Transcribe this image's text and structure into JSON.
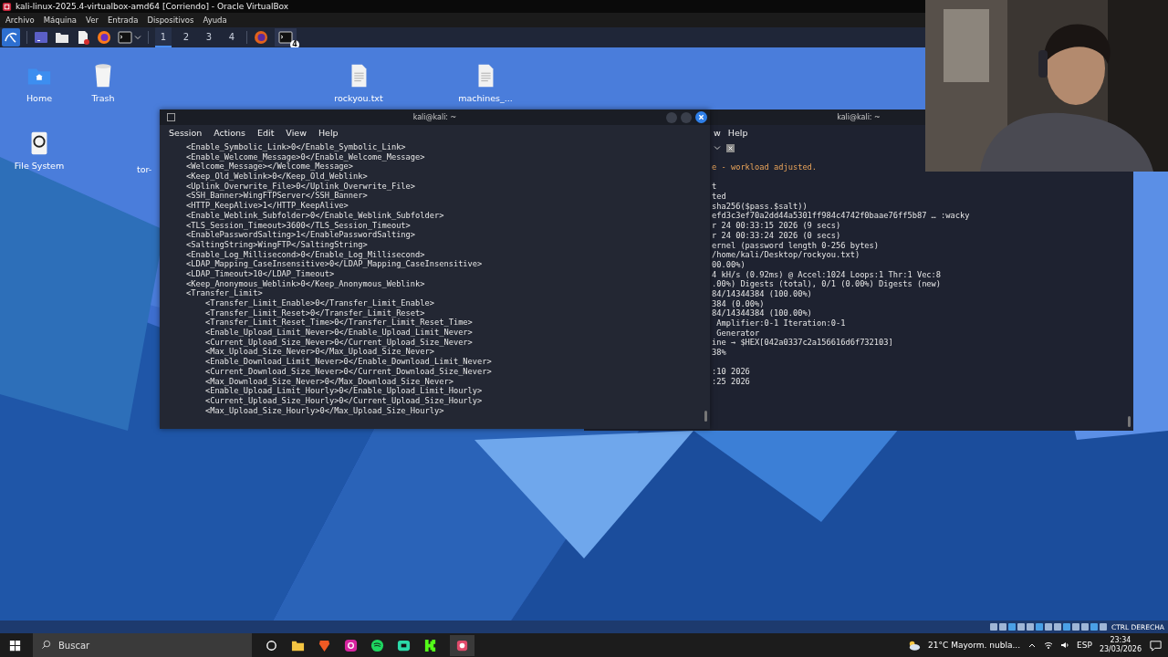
{
  "vm_window": {
    "title": "kali-linux-2025.4-virtualbox-amd64 [Corriendo] - Oracle VirtualBox",
    "menu": [
      "Archivo",
      "Máquina",
      "Ver",
      "Entrada",
      "Dispositivos",
      "Ayuda"
    ]
  },
  "panel": {
    "workspaces": [
      {
        "label": "1",
        "selected": true
      },
      {
        "label": "2",
        "selected": false
      },
      {
        "label": "3",
        "selected": false
      },
      {
        "label": "4",
        "selected": false
      }
    ],
    "terminal_badge": "4"
  },
  "desktop_icons": [
    {
      "label": "Home",
      "kind": "folder"
    },
    {
      "label": "Trash",
      "kind": "trash"
    },
    {
      "label": "rockyou.txt",
      "kind": "file"
    },
    {
      "label": "machines_...",
      "kind": "file"
    },
    {
      "label": "File System",
      "kind": "drive"
    },
    {
      "label": "tor-",
      "kind": "cut"
    }
  ],
  "back_terminal": {
    "title": "kali@kali: ~",
    "menu": [
      "w",
      "Help"
    ],
    "lines": [
      {
        "kind": "warning",
        "text": "e - workload adjusted."
      },
      {
        "kind": "blank"
      },
      {
        "kind": "normal",
        "text": "t"
      },
      {
        "kind": "normal",
        "text": "ted"
      },
      {
        "kind": "normal",
        "text": "sha256($pass.$salt))"
      },
      {
        "kind": "normal",
        "text": "efd3c3ef70a2dd44a5301ff984c4742f0baae76ff5b87 … :wacky"
      },
      {
        "kind": "normal",
        "text": "r 24 00:33:15 2026 (9 secs)"
      },
      {
        "kind": "normal",
        "text": "r 24 00:33:24 2026 (0 secs)"
      },
      {
        "kind": "normal",
        "text": "ernel (password length 0-256 bytes)"
      },
      {
        "kind": "normal",
        "text": "/home/kali/Desktop/rockyou.txt)"
      },
      {
        "kind": "normal",
        "text": "00.00%)"
      },
      {
        "kind": "normal",
        "text": "4 kH/s (0.92ms) @ Accel:1024 Loops:1 Thr:1 Vec:8"
      },
      {
        "kind": "normal",
        "text": ".00%) Digests (total), 0/1 (0.00%) Digests (new)"
      },
      {
        "kind": "normal",
        "text": "84/14344384 (100.00%)"
      },
      {
        "kind": "normal",
        "text": "384 (0.00%)"
      },
      {
        "kind": "normal",
        "text": "84/14344384 (100.00%)"
      },
      {
        "kind": "normal",
        "text": " Amplifier:0-1 Iteration:0-1"
      },
      {
        "kind": "normal",
        "text": " Generator"
      },
      {
        "kind": "normal",
        "text": "ine → $HEX[042a0337c2a156616d6f732103]"
      },
      {
        "kind": "normal",
        "text": "38%"
      },
      {
        "kind": "blank"
      },
      {
        "kind": "normal",
        "text": ":10 2026"
      },
      {
        "kind": "normal",
        "text": ":25 2026"
      }
    ]
  },
  "front_terminal": {
    "title": "kali@kali: ~",
    "menu": [
      "Session",
      "Actions",
      "Edit",
      "View",
      "Help"
    ],
    "lines": [
      "<Enable_Symbolic_Link>0</Enable_Symbolic_Link>",
      "<Enable_Welcome_Message>0</Enable_Welcome_Message>",
      "<Welcome_Message></Welcome_Message>",
      "<Keep_Old_Weblink>0</Keep_Old_Weblink>",
      "<Uplink_Overwrite_File>0</Uplink_Overwrite_File>",
      "<SSH_Banner>WingFTPServer</SSH_Banner>",
      "<HTTP_KeepAlive>1</HTTP_KeepAlive>",
      "<Enable_Weblink_Subfolder>0</Enable_Weblink_Subfolder>",
      "<TLS_Session_Timeout>3600</TLS_Session_Timeout>",
      "<EnablePasswordSalting>1</EnablePasswordSalting>",
      "<SaltingString>WingFTP</SaltingString>",
      "<Enable_Log_Millisecond>0</Enable_Log_Millisecond>",
      "<LDAP_Mapping_CaseInsensitive>0</LDAP_Mapping_CaseInsensitive>",
      "<LDAP_Timeout>10</LDAP_Timeout>",
      "<Keep_Anonymous_Weblink>0</Keep_Anonymous_Weblink>",
      "<Transfer_Limit>",
      "    <Transfer_Limit_Enable>0</Transfer_Limit_Enable>",
      "    <Transfer_Limit_Reset>0</Transfer_Limit_Reset>",
      "    <Transfer_Limit_Reset_Time>0</Transfer_Limit_Reset_Time>",
      "    <Enable_Upload_Limit_Never>0</Enable_Upload_Limit_Never>",
      "    <Current_Upload_Size_Never>0</Current_Upload_Size_Never>",
      "    <Max_Upload_Size_Never>0</Max_Upload_Size_Never>",
      "    <Enable_Download_Limit_Never>0</Enable_Download_Limit_Never>",
      "    <Current_Download_Size_Never>0</Current_Download_Size_Never>",
      "    <Max_Download_Size_Never>0</Max_Download_Size_Never>",
      "    <Enable_Upload_Limit_Hourly>0</Enable_Upload_Limit_Hourly>",
      "    <Current_Upload_Size_Hourly>0</Current_Upload_Size_Hourly>",
      "    <Max_Upload_Size_Hourly>0</Max_Upload_Size_Hourly>"
    ]
  },
  "vm_status": {
    "host_key": "CTRL DERECHA"
  },
  "taskbar": {
    "search_placeholder": "Buscar",
    "weather": "21°C Mayorm. nubla...",
    "language": "ESP",
    "time": "23:34",
    "date": "23/03/2026"
  }
}
